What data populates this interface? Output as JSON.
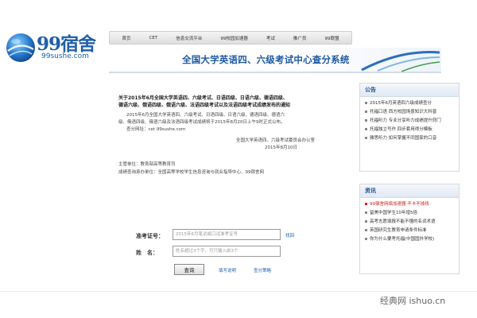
{
  "logo": {
    "title": "99宿舍",
    "domain": "99sushe.com"
  },
  "nav": {
    "items": [
      "首页",
      "CET",
      "信息交流平台",
      "99校园加速器",
      "考试",
      "推广员",
      "99联盟"
    ]
  },
  "header": {
    "title": "全国大学英语四、六级考试中心查分系统"
  },
  "main": {
    "lines": [
      "关于2015年6月全国大学英语四、六级考试、日语四级、日语六级、德语四级、",
      "德语六级、俄语四级、俄语六级、法语四级考试以及法语四级考试成绩发布的通知",
      "2015年6月全国大学英语四、六级考试、日语四级、日语六级、德语四级、德语六",
      "级、俄语四级、俄语六级及法语四级考试成绩将于2015年8月20日上午9时正式公布。",
      "查分网址：cet.99sushe.com",
      "全国大学英语四、六级考试委员会办公室",
      "2015年8月10日",
      "主管单位：教育部高等教育司",
      "成绩查询承办单位：全国高等学校学生信息咨询与就业指导中心、99宿舍网"
    ],
    "form": {
      "ticket_label": "准考证号：",
      "ticket_placeholder": "2015年6月笔试或口试准考证号",
      "ticket_help": "找回",
      "name_label": "姓　名：",
      "name_placeholder": "姓名超过3个字，可只输入前3个",
      "query_button": "查询",
      "link_help": "填写说明",
      "link_strategy": "查分策略"
    }
  },
  "sidebar": {
    "notice": {
      "title": "公告",
      "items": [
        "2015年6月英语四六级成绩查分",
        "托福口语 西方校园场景知识大科普",
        "托福听力 专业分享听力成绩提升窍门",
        "托福独立写作 四步套用得分模板",
        "雅思听力 如何掌握不同国家的口音"
      ]
    },
    "news": {
      "title": "资讯",
      "items": [
        "99宿舍网络加速器 不卡不掉线",
        "留美中国学生10年增5倍",
        "高考志愿填报不能不懂的名词术语",
        "英国研究生教育申请条件标准",
        "你为什么要考托福(中国国外学校)"
      ],
      "highlight_color": "#d21a1a"
    }
  },
  "watermark": "经典网 ishuo.cn",
  "colors": {
    "brand_blue": "#1e5aa3",
    "link_blue": "#2060b0",
    "alert_red": "#d21a1a"
  }
}
